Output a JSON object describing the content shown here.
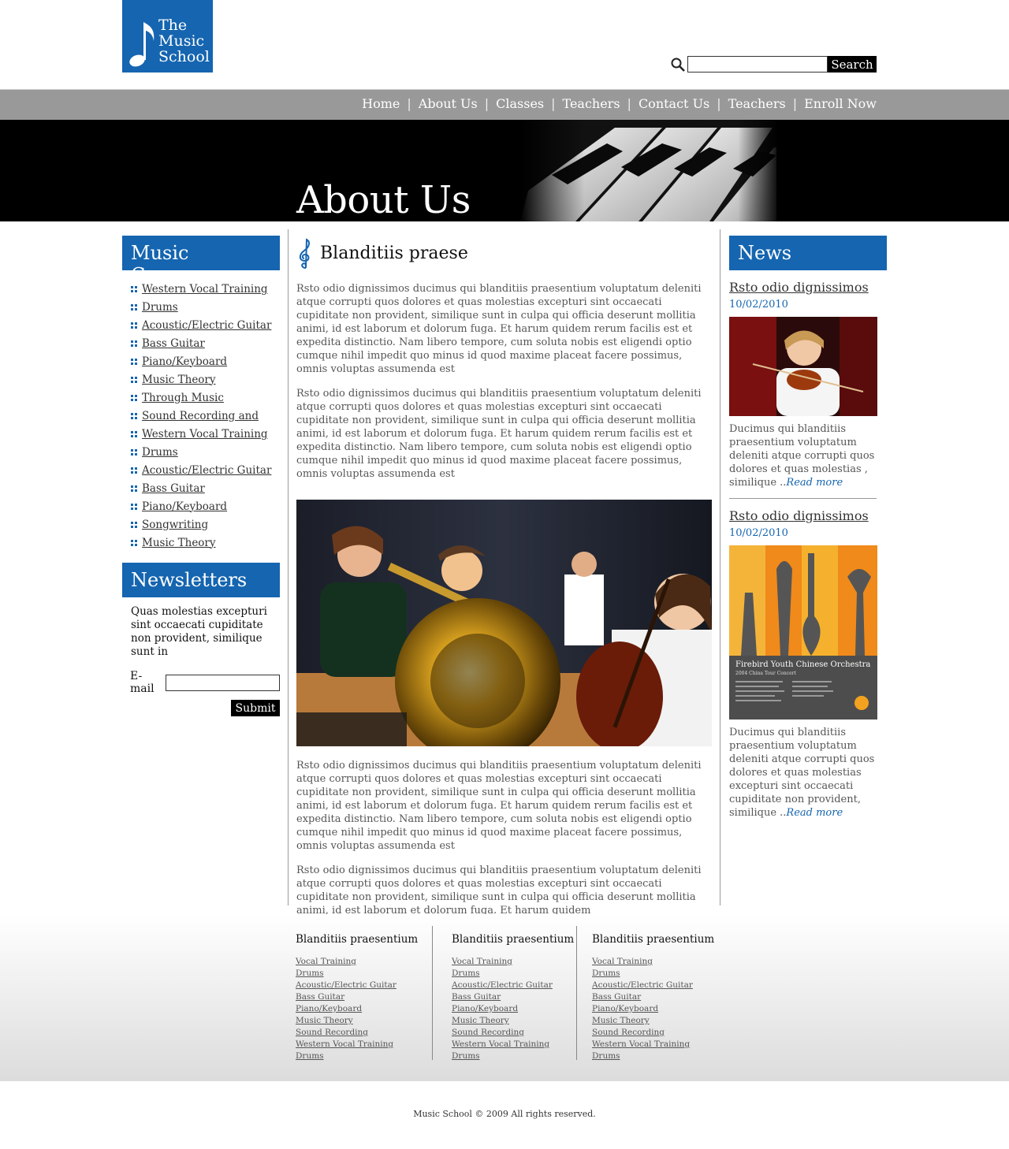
{
  "brand": {
    "line1": "The",
    "line2": "Music",
    "line3": "School",
    "color": "#1565b0"
  },
  "search": {
    "button": "Search",
    "placeholder": ""
  },
  "nav": [
    "Home",
    "About Us",
    "Classes",
    "Teachers",
    "Contact Us",
    "Teachers",
    "Enroll Now"
  ],
  "banner": {
    "title": "About Us"
  },
  "left": {
    "courses_title": "Music Courses",
    "courses": [
      "Western Vocal Training",
      "Drums",
      "Acoustic/Electric Guitar",
      "Bass Guitar",
      "Piano/Keyboard",
      "Music Theory",
      "Through Music",
      "Sound Recording and",
      "Western Vocal Training",
      "Drums",
      "Acoustic/Electric Guitar",
      "Bass Guitar",
      "Piano/Keyboard",
      "Songwriting",
      "Music Theory"
    ],
    "newsletter_title": "Newsletters",
    "newsletter_text": "Quas molestias excepturi sint occaecati cupiditate non provident, similique sunt in",
    "email_label": "E-mail",
    "submit": "Submit"
  },
  "center": {
    "heading": "Blanditiis praese",
    "p1": "Rsto odio dignissimos ducimus qui blanditiis praesentium voluptatum deleniti atque corrupti quos dolores et quas molestias excepturi sint occaecati cupiditate non provident, similique sunt in culpa qui officia deserunt mollitia animi, id est laborum et dolorum fuga. Et harum quidem rerum facilis est et expedita distinctio. Nam libero tempore, cum soluta nobis est eligendi optio cumque nihil impedit quo minus id quod maxime placeat facere possimus, omnis voluptas assumenda est",
    "p2": "Rsto odio dignissimos ducimus qui blanditiis praesentium voluptatum deleniti atque corrupti quos dolores et quas molestias excepturi sint occaecati cupiditate non provident, similique sunt in culpa qui officia deserunt mollitia animi, id est laborum et dolorum fuga. Et harum quidem rerum facilis est et expedita distinctio. Nam libero tempore, cum soluta nobis est eligendi optio cumque nihil impedit quo minus id quod maxime placeat facere possimus, omnis voluptas assumenda est",
    "p3": "Rsto odio dignissimos ducimus qui blanditiis praesentium voluptatum deleniti atque corrupti quos dolores et quas molestias excepturi sint occaecati cupiditate non provident, similique sunt in culpa qui officia deserunt mollitia animi, id est laborum et dolorum fuga. Et harum quidem rerum facilis est et expedita distinctio. Nam libero tempore, cum soluta nobis est eligendi optio cumque nihil impedit quo minus id quod maxime placeat facere possimus, omnis voluptas assumenda est",
    "p4": "Rsto odio dignissimos ducimus qui blanditiis praesentium voluptatum deleniti atque corrupti quos dolores et quas molestias excepturi sint occaecati cupiditate non provident, similique sunt in culpa qui officia deserunt mollitia animi, id est laborum et dolorum fuga. Et harum quidem"
  },
  "news": {
    "title": "News",
    "items": [
      {
        "title": "Rsto odio dignissimos",
        "date": "10/02/2010",
        "text": "Ducimus qui blanditiis praesentium voluptatum deleniti atque corrupti quos dolores et quas molestias , similique ..",
        "more": "Read more"
      },
      {
        "title": "Rsto odio dignissimos",
        "date": "10/02/2010",
        "text": "Ducimus qui blanditiis praesentium voluptatum deleniti atque corrupti quos dolores et quas molestias excepturi sint occaecati cupiditate non provident, similique ..",
        "more": "Read more",
        "poster_title": "Firebird Youth Chinese Orchestra",
        "poster_sub": "2004 China Tour Concert"
      }
    ]
  },
  "footer": {
    "columns": [
      {
        "title": "Blanditiis praesentium",
        "links": [
          "Vocal Training",
          "Drums",
          "Acoustic/Electric Guitar",
          "Bass Guitar",
          "Piano/Keyboard",
          "Music Theory",
          "Sound Recording",
          "Western Vocal Training",
          "Drums"
        ]
      },
      {
        "title": "Blanditiis praesentium",
        "links": [
          "Vocal Training",
          "Drums",
          "Acoustic/Electric Guitar",
          "Bass Guitar",
          "Piano/Keyboard",
          "Music Theory",
          "Sound Recording",
          "Western Vocal Training",
          "Drums"
        ]
      },
      {
        "title": "Blanditiis praesentium",
        "links": [
          "Vocal Training",
          "Drums",
          "Acoustic/Electric Guitar",
          "Bass Guitar",
          "Piano/Keyboard",
          "Music Theory",
          "Sound Recording",
          "Western Vocal Training",
          "Drums"
        ]
      }
    ],
    "copyright": "Music School © 2009 All rights reserved."
  }
}
